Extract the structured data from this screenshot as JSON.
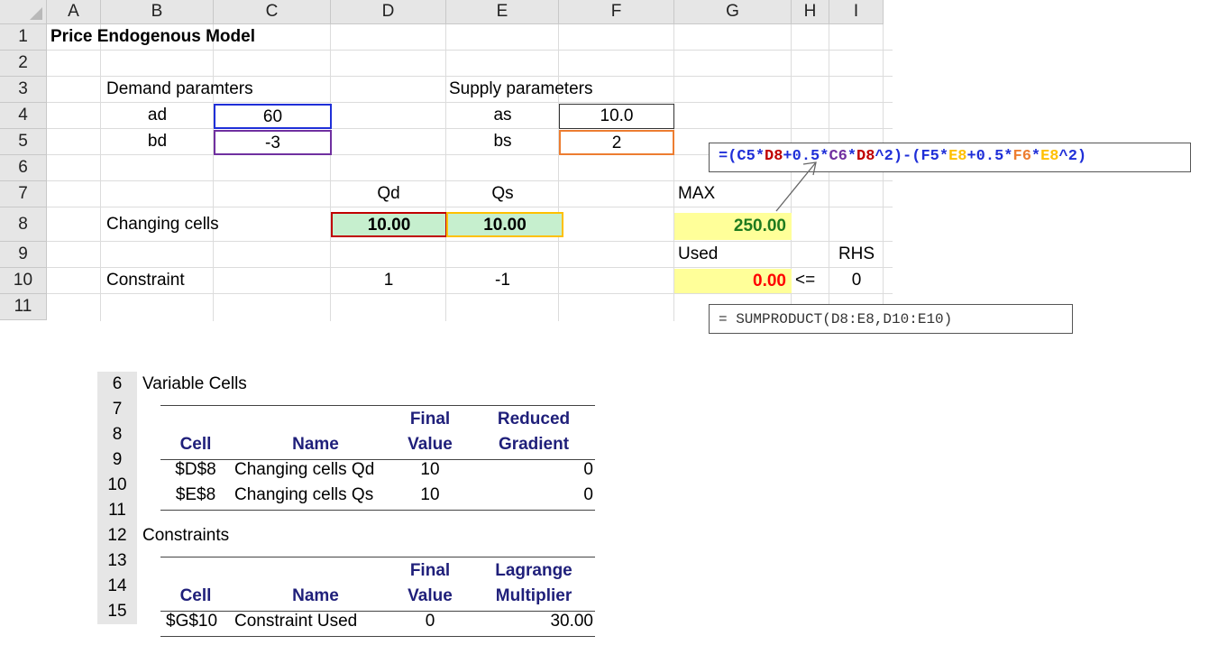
{
  "columns": [
    "A",
    "B",
    "C",
    "D",
    "E",
    "F",
    "G",
    "H",
    "I"
  ],
  "rows": [
    "1",
    "2",
    "3",
    "4",
    "5",
    "6",
    "7",
    "8",
    "9",
    "10",
    "11"
  ],
  "sheet": {
    "title": "Price Endogenous Model",
    "demand_label": "Demand paramters",
    "supply_label": "Supply parameters",
    "ad_label": "ad",
    "ad_value": "60",
    "bd_label": "bd",
    "bd_value": "-3",
    "as_label": "as",
    "as_value": "10.0",
    "bs_label": "bs",
    "bs_value": "2",
    "qd_header": "Qd",
    "qs_header": "Qs",
    "changing_label": "Changing cells",
    "qd_value": "10.00",
    "qs_value": "10.00",
    "max_label": "MAX",
    "max_value": "250.00",
    "used_label": "Used",
    "rhs_label": "RHS",
    "constraint_label": "Constraint",
    "coef_d": "1",
    "coef_e": "-1",
    "used_value": "0.00",
    "op": "<=",
    "rhs_value": "0"
  },
  "formula_main": [
    {
      "t": "=(",
      "c": "#1f2fd8"
    },
    {
      "t": "C5",
      "c": "#1f2fd8"
    },
    {
      "t": "*",
      "c": "#1f2fd8"
    },
    {
      "t": "D8",
      "c": "#c00000"
    },
    {
      "t": "+0.5*",
      "c": "#1f2fd8"
    },
    {
      "t": "C6",
      "c": "#7030a0"
    },
    {
      "t": "*",
      "c": "#1f2fd8"
    },
    {
      "t": "D8",
      "c": "#c00000"
    },
    {
      "t": "^2)-(",
      "c": "#1f2fd8"
    },
    {
      "t": "F5",
      "c": "#1f2fd8"
    },
    {
      "t": "*",
      "c": "#1f2fd8"
    },
    {
      "t": "E8",
      "c": "#ffc000"
    },
    {
      "t": "+0.5*",
      "c": "#1f2fd8"
    },
    {
      "t": "F6",
      "c": "#ed7d31"
    },
    {
      "t": "*",
      "c": "#1f2fd8"
    },
    {
      "t": "E8",
      "c": "#ffc000"
    },
    {
      "t": "^2)",
      "c": "#1f2fd8"
    }
  ],
  "formula_used": "= SUMPRODUCT(D8:E8,D10:E10)",
  "report": {
    "row_numbers": [
      "6",
      "7",
      "8",
      "9",
      "10",
      "11",
      "12",
      "13",
      "14",
      "15"
    ],
    "variable_cells_title": "Variable Cells",
    "vc_headers": {
      "final_1": "Final",
      "final_2": "Value",
      "reduced_1": "Reduced",
      "reduced_2": "Gradient",
      "cell": "Cell",
      "name": "Name"
    },
    "vc_rows": [
      {
        "cell": "$D$8",
        "name": "Changing cells Qd",
        "value": "10",
        "extra": "0"
      },
      {
        "cell": "$E$8",
        "name": "Changing cells Qs",
        "value": "10",
        "extra": "0"
      }
    ],
    "constraints_title": "Constraints",
    "c_headers": {
      "final_1": "Final",
      "final_2": "Value",
      "lagrange_1": "Lagrange",
      "lagrange_2": "Multiplier",
      "cell": "Cell",
      "name": "Name"
    },
    "c_rows": [
      {
        "cell": "$G$10",
        "name": "Constraint Used",
        "value": "0",
        "extra": "30.00"
      }
    ]
  },
  "colors": {
    "blue": "#1f2fd8",
    "red": "#c00000",
    "purple": "#7030a0",
    "orange": "#ed7d31",
    "gold": "#ffc000",
    "green_fill": "#c6efce",
    "yellow_fill": "#ffff99",
    "navy": "#1f1f7a"
  }
}
